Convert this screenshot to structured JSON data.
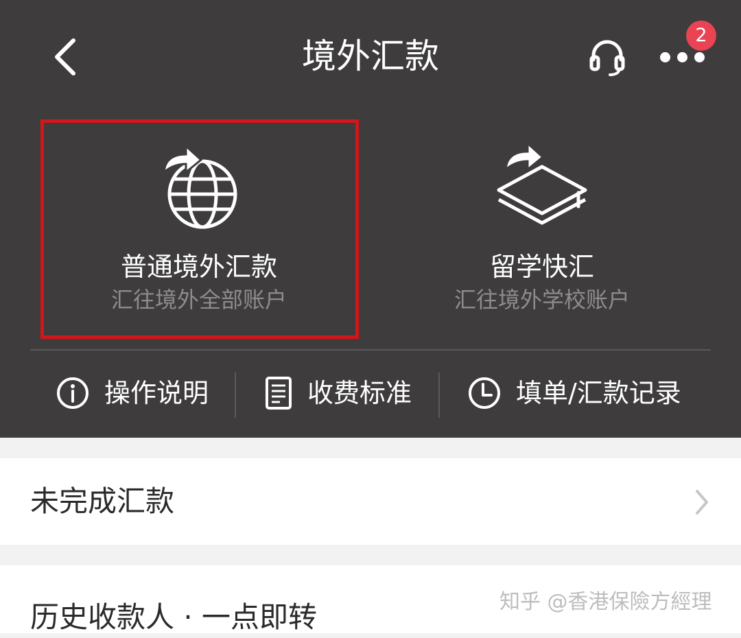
{
  "nav": {
    "title": "境外汇款",
    "badge_count": "2"
  },
  "cards": [
    {
      "title": "普通境外汇款",
      "subtitle": "汇往境外全部账户",
      "highlighted": true
    },
    {
      "title": "留学快汇",
      "subtitle": "汇往境外学校账户",
      "highlighted": false
    }
  ],
  "quick_links": [
    {
      "label": "操作说明",
      "icon": "info-icon"
    },
    {
      "label": "收费标准",
      "icon": "document-icon"
    },
    {
      "label": "填单/汇款记录",
      "icon": "clock-icon"
    }
  ],
  "list": {
    "pending_label": "未完成汇款",
    "history_label": "历史收款人 · 一点即转"
  },
  "watermark": "知乎 @香港保險方經理",
  "colors": {
    "header_bg": "#3e3c3d",
    "highlight_border": "#d41519",
    "badge": "#e94354",
    "page_bg": "#f2f2f2"
  }
}
